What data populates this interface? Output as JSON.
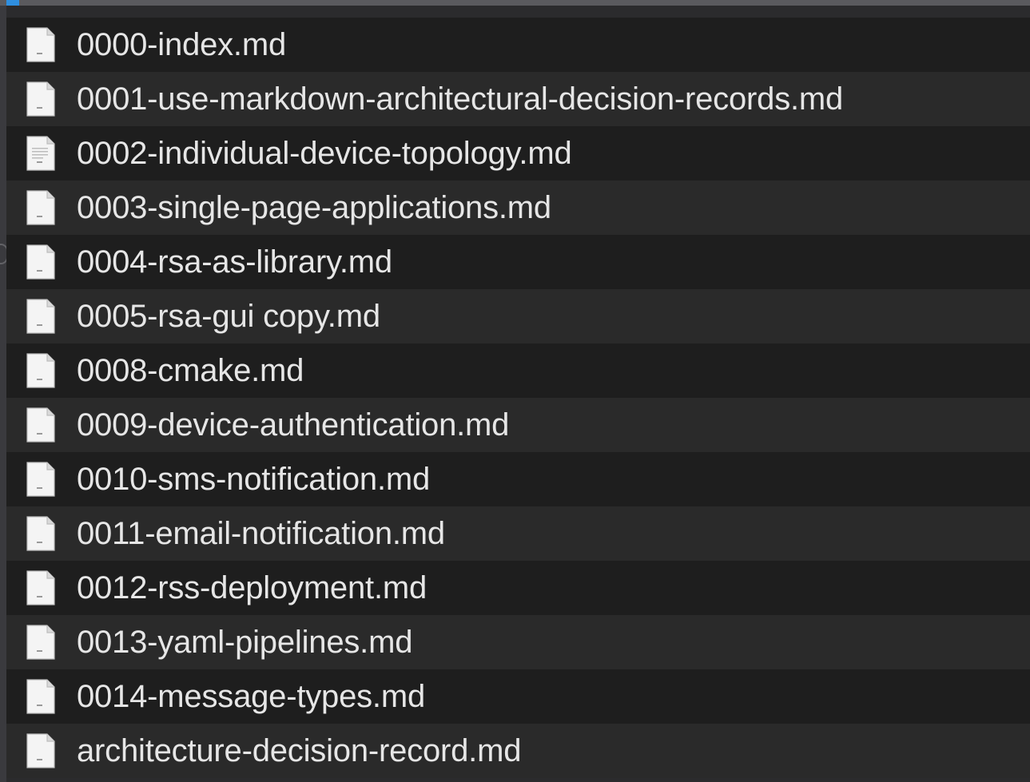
{
  "file_list": {
    "icon": "markdown-document-icon",
    "files": [
      {
        "name": "0000-index.md"
      },
      {
        "name": "0001-use-markdown-architectural-decision-records.md"
      },
      {
        "name": "0002-individual-device-topology.md"
      },
      {
        "name": "0003-single-page-applications.md"
      },
      {
        "name": "0004-rsa-as-library.md"
      },
      {
        "name": "0005-rsa-gui copy.md"
      },
      {
        "name": "0008-cmake.md"
      },
      {
        "name": "0009-device-authentication.md"
      },
      {
        "name": "0010-sms-notification.md"
      },
      {
        "name": "0011-email-notification.md"
      },
      {
        "name": "0012-rss-deployment.md"
      },
      {
        "name": "0013-yaml-pipelines.md"
      },
      {
        "name": "0014-message-types.md"
      },
      {
        "name": "architecture-decision-record.md"
      }
    ]
  },
  "colors": {
    "row_dark": "#1e1e1e",
    "row_light": "#2a2a2a",
    "text": "#e6e6e6",
    "accent": "#2f8fe0"
  }
}
